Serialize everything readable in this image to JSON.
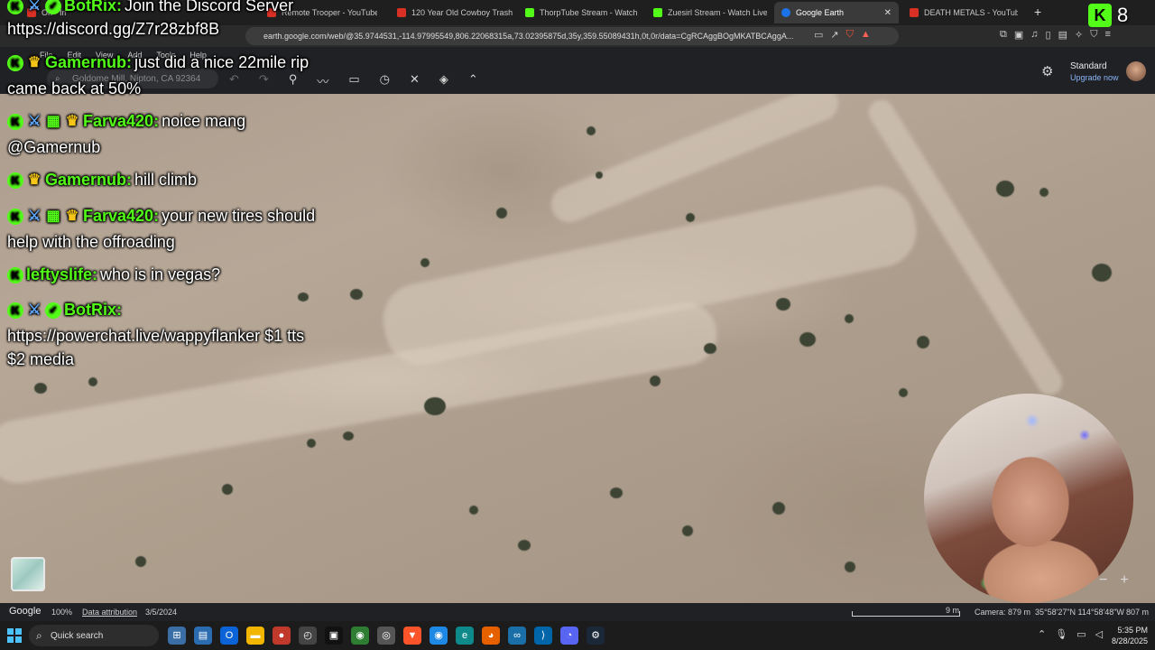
{
  "browser": {
    "tabs": [
      {
        "label": "Ori - Image"
      },
      {
        "label": "Remote Trooper - YouTube"
      },
      {
        "label": "120 Year Old Cowboy Trash - Y"
      },
      {
        "label": "ThorpTube Stream - Watch Liv"
      },
      {
        "label": "Zuesirl Stream - Watch Live"
      },
      {
        "label": "Google Earth",
        "active": true
      },
      {
        "label": "DEATH METALS - YouTube"
      }
    ],
    "tab_colors": [
      "#d93025",
      "#d93025",
      "#d93025",
      "#53fc18",
      "#53fc18",
      "#1a73e8",
      "#d93025"
    ],
    "url": "earth.google.com/web/@35.9744531,-114.97995549,806.22068315a,73.02395875d,35y,359.55089431h,0t,0r/data=CgRCAggBOgMKATBCAggA..."
  },
  "earth": {
    "menu": [
      "File",
      "Edit",
      "View",
      "Add",
      "Tools",
      "Help"
    ],
    "search_placeholder": "Goldome Mill, Nipton, CA 92364",
    "tool_icons": [
      "undo-icon",
      "redo-icon",
      "placemark-icon",
      "path-icon",
      "ruler-icon",
      "history-icon",
      "satellite-icon",
      "layers-icon",
      "chevron-up-icon"
    ],
    "plan_label": "Standard",
    "upgrade_label": "Upgrade now"
  },
  "chat": {
    "header_user": "BotRix:",
    "header_text": "Join the Discord Server",
    "discord_link": "https://discord.gg/Z7r28zbf8B",
    "messages": [
      {
        "user": "Gamernub:",
        "color": "#53fc18",
        "text": "just did a nice 22mile rip",
        "text2": "came back at 50%"
      },
      {
        "user": "Farva420:",
        "color": "#53fc18",
        "text": "noice mang",
        "text2": "@Gamernub"
      },
      {
        "user": "Gamernub:",
        "color": "#53fc18",
        "text": "hill climb"
      },
      {
        "user": "Farva420:",
        "color": "#53fc18",
        "text": "your new tires should",
        "text2": "help with the offroading"
      },
      {
        "user": "leftyslife:",
        "color": "#53fc18",
        "text": "who is in vegas?"
      },
      {
        "user": "BotRix:",
        "color": "#53fc18",
        "text": "",
        "text2": "https://powerchat.live/wappyflanker $1 tts",
        "text3": "$2 media"
      }
    ]
  },
  "kick_overlay": {
    "count": "8"
  },
  "status": {
    "brand": "Google",
    "zoom": "100%",
    "attribution": "Data attribution",
    "date": "3/5/2024",
    "scale": "9 m",
    "camera": "Camera: 879 m",
    "coords": "35°58'27\"N 114°58'48\"W",
    "elevation": "807 m"
  },
  "taskbar": {
    "search_label": "Quick search",
    "apps": [
      "widgets-icon",
      "files-icon",
      "outlook-icon",
      "store-icon",
      "explorer-icon",
      "recorder-icon",
      "clock-icon",
      "terminal-icon",
      "chrome-alt-icon",
      "obs-icon",
      "brave-icon",
      "chrome-icon",
      "edge-icon",
      "firefox-icon",
      "gamebar-icon",
      "vscode-icon",
      "discord-icon",
      "steam-icon"
    ],
    "time": "5:35 PM",
    "date": "8/28/2025"
  }
}
